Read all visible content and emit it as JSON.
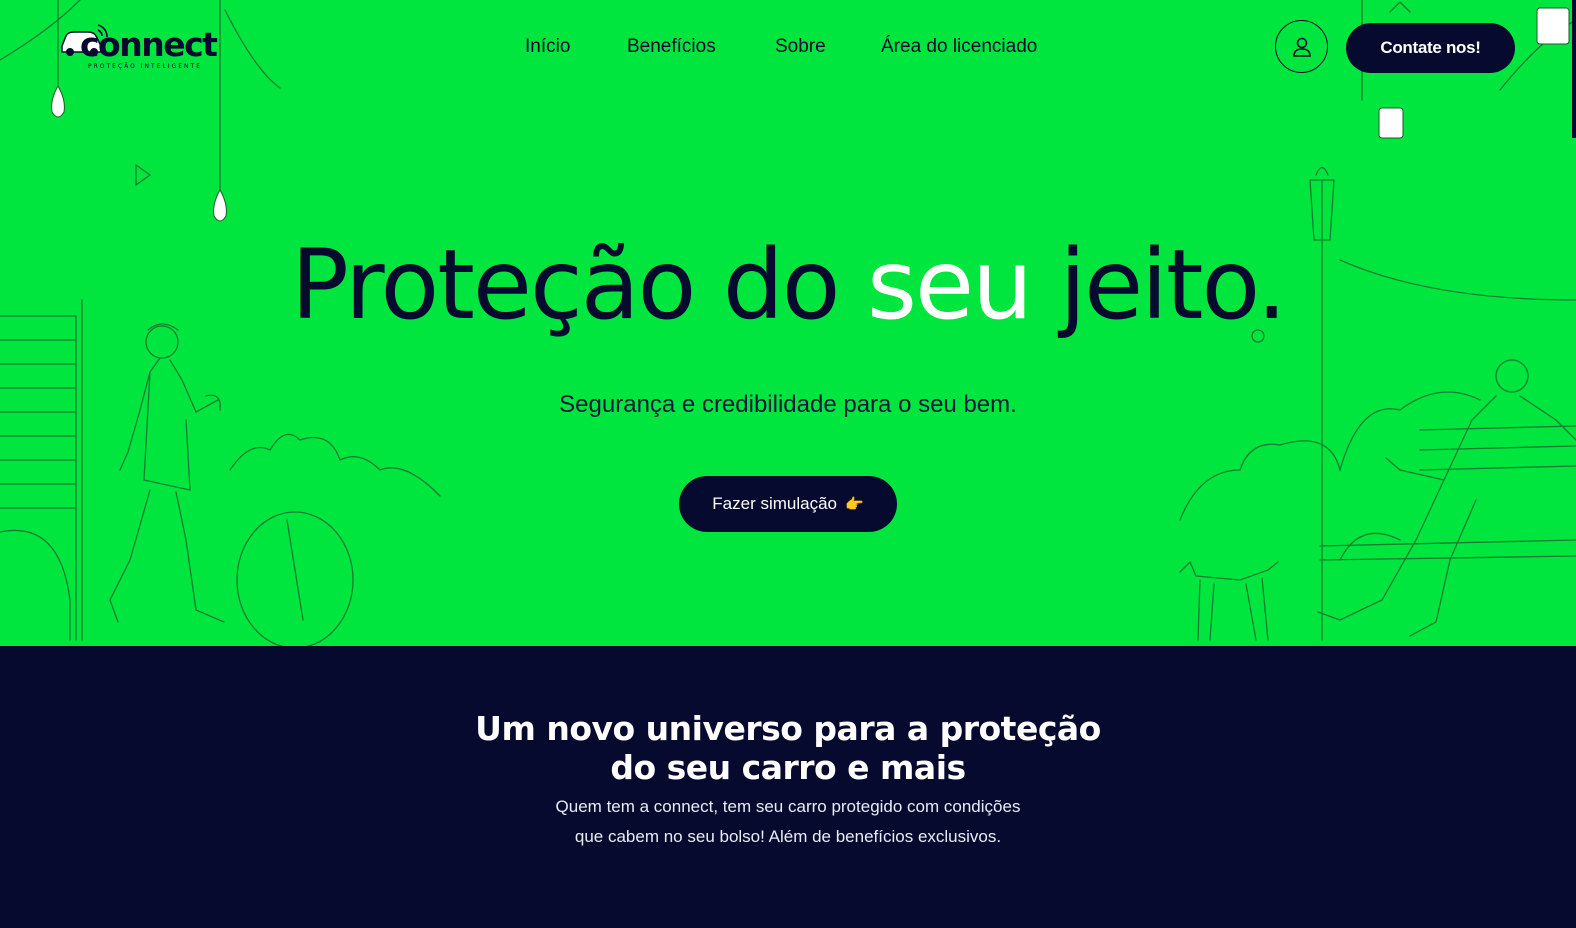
{
  "brand": {
    "name": "connect",
    "tagline": "PROTEÇÃO INTELIGENTE",
    "colors": {
      "primary_green": "#00e63f",
      "navy": "#050a2e",
      "white": "#ffffff"
    }
  },
  "nav": {
    "links": [
      "Início",
      "Benefícios",
      "Sobre",
      "Área do licenciado"
    ],
    "user_icon": "user-icon",
    "contact_label": "Contate nos!"
  },
  "hero": {
    "headline_part1": "Proteção do ",
    "headline_highlight": "seu",
    "headline_part2": " jeito.",
    "subheadline": "Segurança e credibilidade para o seu bem.",
    "cta_label": "Fazer simulação",
    "cta_icon": "pointing-hand-icon",
    "cta_emoji": "👉"
  },
  "section": {
    "title_line1": "Um novo universo para a proteção",
    "title_line2": "do seu carro e mais",
    "text_line1": "Quem tem a connect, tem seu carro protegido com condições",
    "text_line2": "que cabem no seu bolso! Além de benefícios exclusivos."
  }
}
